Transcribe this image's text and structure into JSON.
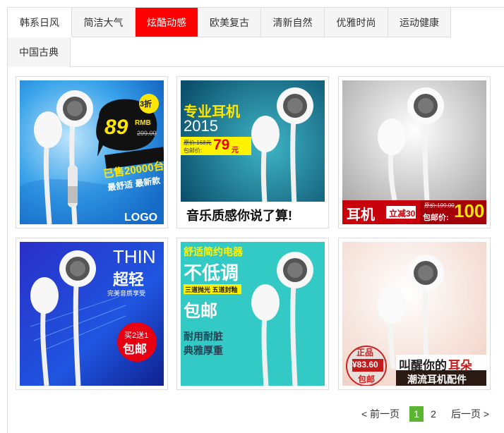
{
  "tabs": [
    {
      "label": "韩系日风"
    },
    {
      "label": "简洁大气"
    },
    {
      "label": "炫酷动感"
    },
    {
      "label": "欧美复古"
    },
    {
      "label": "清新自然"
    },
    {
      "label": "优雅时尚"
    },
    {
      "label": "运动健康"
    },
    {
      "label": "中国古典"
    }
  ],
  "active_tab": "炫酷动感",
  "thumbnails": [
    {
      "discount": "3折",
      "price": "89",
      "currency": "RMB",
      "old_price": "299.00",
      "sold": "已售20000台",
      "slogan": "最舒适 最新款",
      "logo": "LOGO"
    },
    {
      "title_a": "专业耳机",
      "year": "2015",
      "old_price_label": "原价:168元",
      "promo_label": "包邮价:",
      "price": "79",
      "price_unit": "元",
      "slogan": "音乐质感你说了算!"
    },
    {
      "product": "耳机",
      "discount": "立减30",
      "old_price": "原价:199.00",
      "promo_label": "包邮价:",
      "price": "100"
    },
    {
      "title_en": "THIN",
      "title_cn": "超轻",
      "subtitle": "完美音质享受",
      "offer_top": "买2送1",
      "offer_bottom": "包邮"
    },
    {
      "category": "舒适简约电器",
      "headline": "不低调",
      "badge": "三道抛光 五道封釉",
      "shipping": "包邮",
      "slogan_1": "耐用耐脏",
      "slogan_2": "典雅厚重"
    },
    {
      "genuine": "正品",
      "price": "¥83.60",
      "shipping": "包邮",
      "slogan_1a": "叫醒你的",
      "slogan_1b": "耳朵",
      "slogan_2": "潮流耳机配件"
    }
  ],
  "pagination": {
    "prev": "< 前一页",
    "pages": [
      "1",
      "2"
    ],
    "current": "1",
    "next": "后一页 >"
  },
  "colors": {
    "active_tab": "#ff0000",
    "current_page": "#5cb531",
    "border": "#dddddd"
  }
}
